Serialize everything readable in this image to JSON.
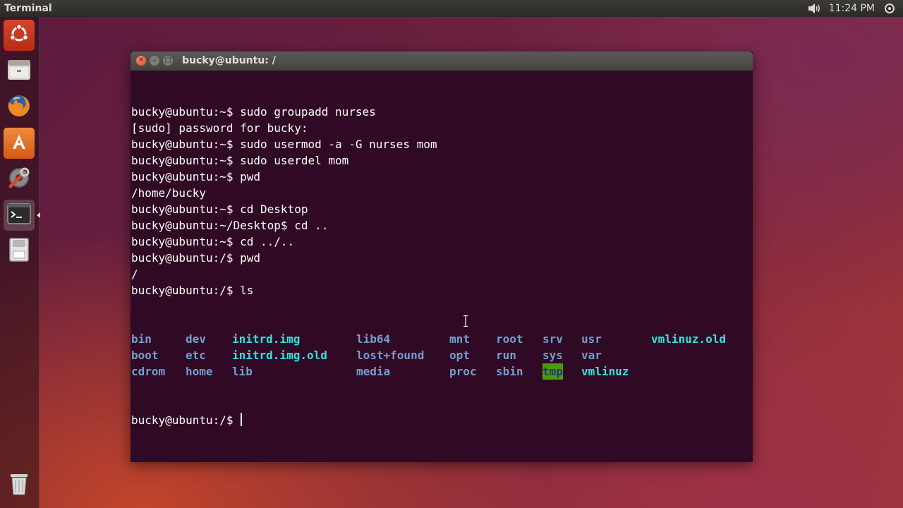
{
  "panel": {
    "app_title": "Terminal",
    "clock": "11:24 PM",
    "icons": [
      "volume-icon"
    ]
  },
  "launcher": {
    "items": [
      "dash-home-icon",
      "files-icon",
      "firefox-icon",
      "software-center-icon",
      "system-settings-icon",
      "terminal-icon",
      "drive-icon",
      "trash-icon"
    ]
  },
  "window": {
    "title": "bucky@ubuntu: /"
  },
  "terminal": {
    "lines": [
      "bucky@ubuntu:~$ sudo groupadd nurses",
      "[sudo] password for bucky:",
      "bucky@ubuntu:~$ sudo usermod -a -G nurses mom",
      "bucky@ubuntu:~$ sudo userdel mom",
      "bucky@ubuntu:~$ pwd",
      "/home/bucky",
      "bucky@ubuntu:~$ cd Desktop",
      "bucky@ubuntu:~/Desktop$ cd ..",
      "bucky@ubuntu:~$ cd ../..",
      "bucky@ubuntu:/$ pwd",
      "/",
      "bucky@ubuntu:/$ ls"
    ],
    "ls_rows": [
      [
        "bin",
        "dev",
        "initrd.img",
        "lib64",
        "mnt",
        "root",
        "srv",
        "usr",
        "vmlinuz.old"
      ],
      [
        "boot",
        "etc",
        "initrd.img.old",
        "lost+found",
        "opt",
        "run",
        "sys",
        "var",
        ""
      ],
      [
        "cdrom",
        "home",
        "lib",
        "media",
        "proc",
        "sbin",
        "tmp",
        "vmlinuz",
        ""
      ]
    ],
    "prompt": "bucky@ubuntu:/$ ",
    "colors": {
      "background": "#300a24",
      "directory": "#729fcf",
      "symlink": "#34e2e2",
      "sticky_bg": "#4e9a06"
    }
  }
}
